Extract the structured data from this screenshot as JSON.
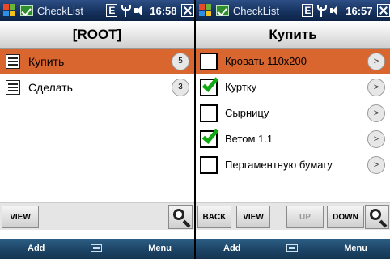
{
  "left": {
    "status": {
      "app_title": "CheckList",
      "network": "E",
      "time": "16:58"
    },
    "header": "[ROOT]",
    "items": [
      {
        "label": "Купить",
        "count": "5",
        "selected": true
      },
      {
        "label": "Сделать",
        "count": "3",
        "selected": false
      }
    ],
    "toolbar": {
      "view": "VIEW"
    },
    "softkeys": {
      "left": "Add",
      "right": "Menu"
    }
  },
  "right": {
    "status": {
      "app_title": "CheckList",
      "network": "E",
      "time": "16:57"
    },
    "header": "Купить",
    "items": [
      {
        "label": "Кровать 110x200",
        "checked": false,
        "selected": true,
        "arrow": ">"
      },
      {
        "label": "Куртку",
        "checked": true,
        "selected": false,
        "arrow": ">"
      },
      {
        "label": "Сырницу",
        "checked": false,
        "selected": false,
        "arrow": ">"
      },
      {
        "label": "Ветом 1.1",
        "checked": true,
        "selected": false,
        "arrow": ">"
      },
      {
        "label": "Пергаментную бумагу",
        "checked": false,
        "selected": false,
        "arrow": ">"
      }
    ],
    "toolbar": {
      "back": "BACK",
      "view": "VIEW",
      "up": "UP",
      "down": "DOWN"
    },
    "softkeys": {
      "left": "Add",
      "right": "Menu"
    }
  },
  "colors": {
    "selection": "#d9652f",
    "check": "#12a912",
    "statusbar": "#16325f"
  },
  "icons": [
    "windows-start-icon",
    "checklist-app-icon",
    "edge-network-icon",
    "antenna-icon",
    "volume-icon",
    "close-icon",
    "note-icon",
    "checkbox-icon",
    "search-icon",
    "keyboard-icon"
  ]
}
